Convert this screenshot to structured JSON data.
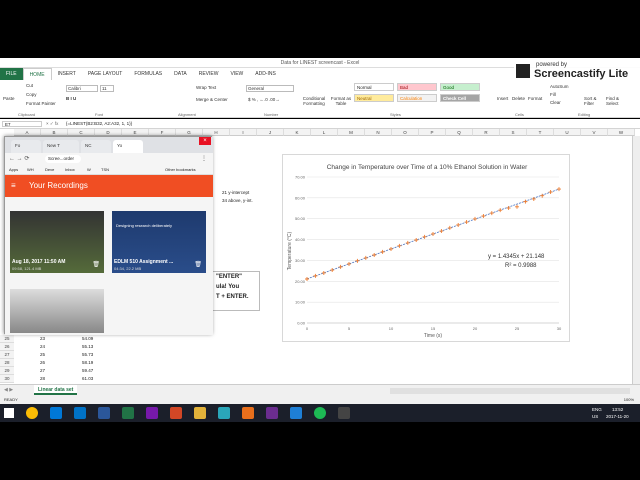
{
  "window": {
    "title": "Data for LINEST screencast - Excel"
  },
  "ribbon_tabs": [
    "FILE",
    "HOME",
    "INSERT",
    "PAGE LAYOUT",
    "FORMULAS",
    "DATA",
    "REVIEW",
    "VIEW",
    "ADD-INS"
  ],
  "ribbon": {
    "paste": "Paste",
    "cut": "Cut",
    "copy": "Copy",
    "format_painter": "Format Painter",
    "font": "Calibri",
    "font_size": "11",
    "wrap_text": "Wrap Text",
    "merge": "Merge & Center",
    "number_format": "General",
    "cond_format": "Conditional Formatting",
    "format_table": "Format as Table",
    "normal": "Normal",
    "bad": "Bad",
    "good": "Good",
    "neutral": "Neutral",
    "calculation": "Calculation",
    "check_cell": "Check Cell",
    "insert": "Insert",
    "delete": "Delete",
    "format": "Format",
    "autosum": "AutoSum",
    "fill": "Fill",
    "clear": "Clear",
    "sort": "Sort & Filter",
    "find": "Find & Select",
    "groups": [
      "Clipboard",
      "Font",
      "Alignment",
      "Number",
      "Styles",
      "Cells",
      "Editing"
    ]
  },
  "formula_bar": {
    "name_box": "E7",
    "formula": "{=LINEST(B2:B32, A2:A32, 1, 1)}"
  },
  "columns": [
    "A",
    "B",
    "C",
    "D",
    "E",
    "F",
    "G",
    "H",
    "I",
    "J",
    "K",
    "L",
    "M",
    "N",
    "O",
    "P",
    "Q",
    "R",
    "S",
    "T",
    "U",
    "V",
    "W"
  ],
  "visible_rows": [
    {
      "n": "25",
      "a": "23",
      "b": "54.09"
    },
    {
      "n": "26",
      "a": "24",
      "b": "55.13"
    },
    {
      "n": "27",
      "a": "25",
      "b": "55.73"
    },
    {
      "n": "28",
      "a": "26",
      "b": "58.19"
    },
    {
      "n": "29",
      "a": "27",
      "b": "59.47"
    },
    {
      "n": "30",
      "a": "28",
      "b": "61.03"
    }
  ],
  "side_text": {
    "t1": "21 y-intercept",
    "t2": "34 above, y-int.",
    "t3": "\"ENTER\"",
    "t4": "ula! You",
    "t5": "T + ENTER."
  },
  "sheet_tab": "Linear data set",
  "status": {
    "ready": "READY",
    "zoom": "100%"
  },
  "taskbar": {
    "lang": "ENG",
    "region": "US",
    "time": "13:52",
    "date": "2017-11-20"
  },
  "screencastify": {
    "line1": "powered by",
    "line2": "Screencastify Lite"
  },
  "chrome": {
    "tabs": [
      "Fo",
      "New T",
      "NC",
      "Yo"
    ],
    "address": "Scree...order",
    "bookmarks": [
      "Apps",
      "WH",
      "Deve",
      "Inbox",
      "W",
      "TSN",
      "Other bookmarks"
    ],
    "header": "Your Recordings",
    "recordings": [
      {
        "title": "Aug 18, 2017 11:50 AM",
        "meta": "09:58, 121.4 MB"
      },
      {
        "title": "EDLM 510 Assignment ...",
        "meta": "04:34, 22.2 MB"
      }
    ],
    "thumb2_caption": "Designing research deliberately",
    "accent": "#f04e23"
  },
  "chart_data": {
    "type": "scatter",
    "title": "Change in Temperature over Time of a 10% Ethanol Solution in Water",
    "xlabel": "Time (s)",
    "ylabel": "Temperature (°C)",
    "xlim": [
      0,
      30
    ],
    "ylim": [
      0,
      70
    ],
    "xticks": [
      0,
      5,
      10,
      15,
      20,
      25,
      30
    ],
    "yticks": [
      "0.00",
      "10.00",
      "20.00",
      "30.00",
      "40.00",
      "50.00",
      "60.00",
      "70.00"
    ],
    "x": [
      0,
      1,
      2,
      3,
      4,
      5,
      6,
      7,
      8,
      9,
      10,
      11,
      12,
      13,
      14,
      15,
      16,
      17,
      18,
      19,
      20,
      21,
      22,
      23,
      24,
      25,
      26,
      27,
      28,
      29,
      30
    ],
    "y": [
      21.1,
      22.6,
      24.0,
      25.4,
      26.9,
      28.3,
      29.8,
      31.2,
      32.6,
      34.1,
      35.5,
      37.0,
      38.4,
      39.8,
      41.3,
      42.7,
      44.1,
      45.6,
      47.0,
      48.4,
      49.9,
      51.3,
      52.7,
      54.09,
      55.13,
      55.73,
      58.19,
      59.47,
      61.03,
      62.8,
      64.2
    ],
    "trendline": {
      "slope": 1.4345,
      "intercept": 21.148,
      "equation": "y = 1.4345x + 21.148",
      "r2": "R² = 0.9988"
    },
    "marker_color": "#ed7d31",
    "line_color": "#4472c4"
  }
}
